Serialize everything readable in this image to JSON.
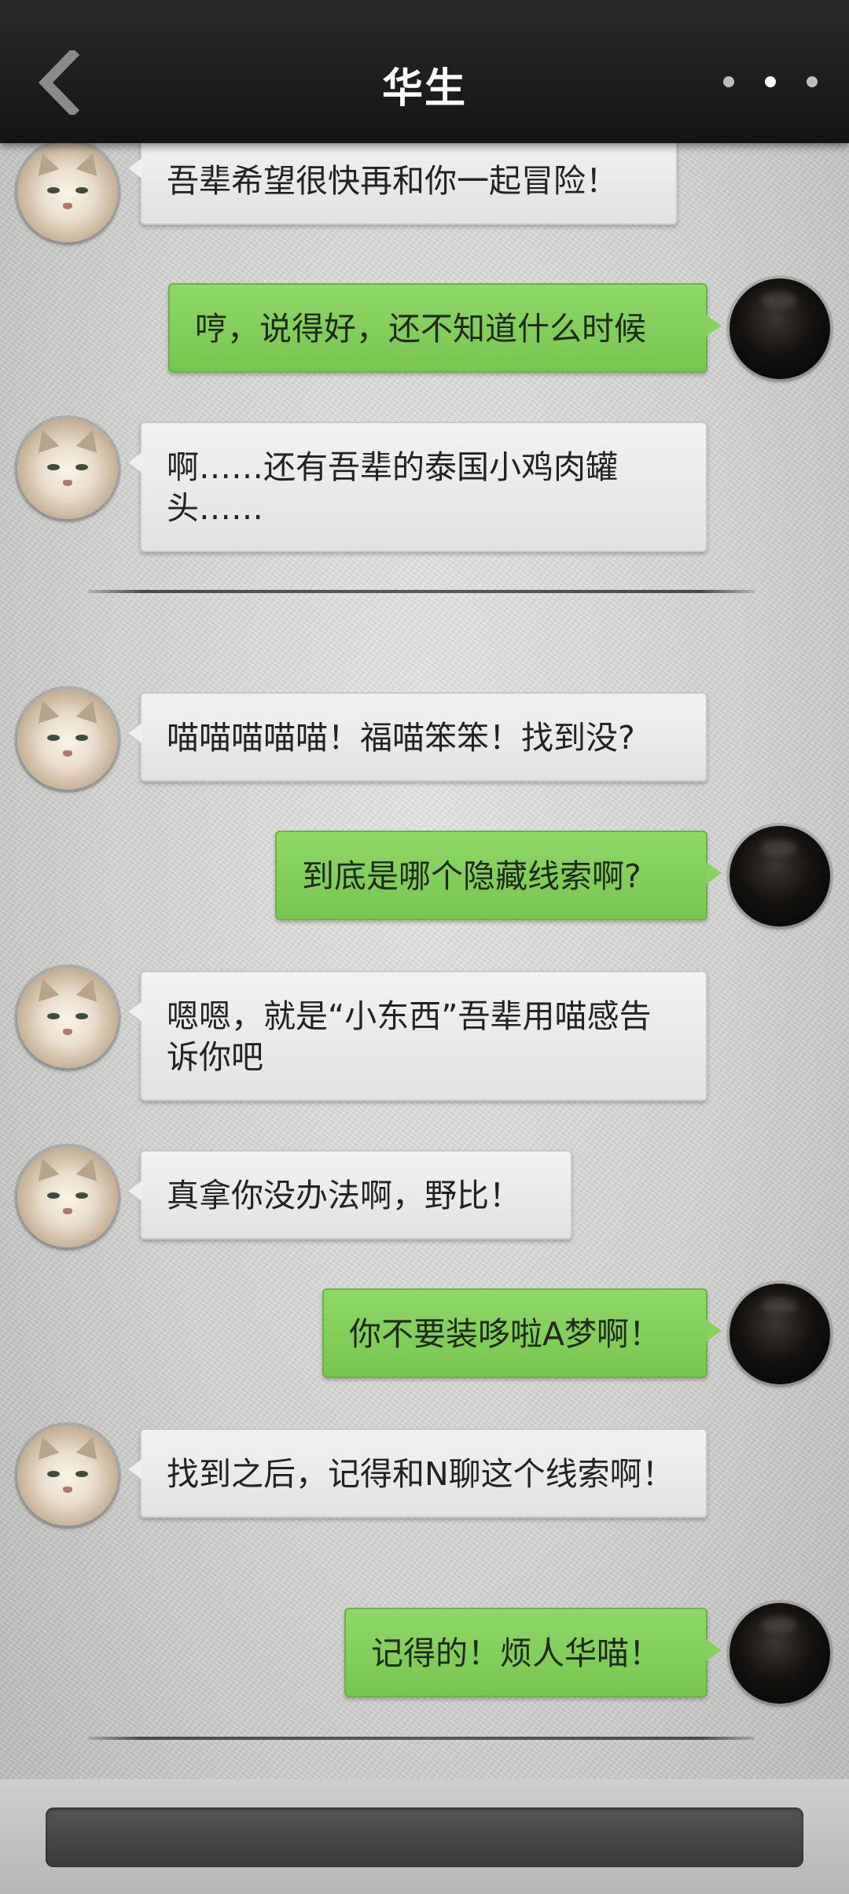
{
  "header": {
    "title": "华生",
    "back_icon": "chevron-left-icon",
    "more_icon": "more-dots-icon"
  },
  "messages": [
    {
      "side": "left",
      "text": "吾辈希望很快再和你一起冒险！"
    },
    {
      "side": "right",
      "text": "哼，说得好，还不知道什么时候"
    },
    {
      "side": "left",
      "text": "啊……还有吾辈的泰国小鸡肉罐头……"
    },
    {
      "side": "left",
      "text": "喵喵喵喵喵！福喵笨笨！找到没?"
    },
    {
      "side": "right",
      "text": "到底是哪个隐藏线索啊?"
    },
    {
      "side": "left",
      "text": "嗯嗯，就是“小东西”吾辈用喵感告诉你吧"
    },
    {
      "side": "left",
      "text": "真拿你没办法啊，野比！"
    },
    {
      "side": "right",
      "text": "你不要装哆啦A梦啊！"
    },
    {
      "side": "left",
      "text": "找到之后，记得和N聊这个线索啊！"
    },
    {
      "side": "right",
      "text": "记得的！烦人华喵！"
    }
  ],
  "input": {
    "value": ""
  },
  "colors": {
    "header_bg": "#1a1a1a",
    "right_bubble": "#83cd5a",
    "left_bubble": "#eaeae8"
  }
}
